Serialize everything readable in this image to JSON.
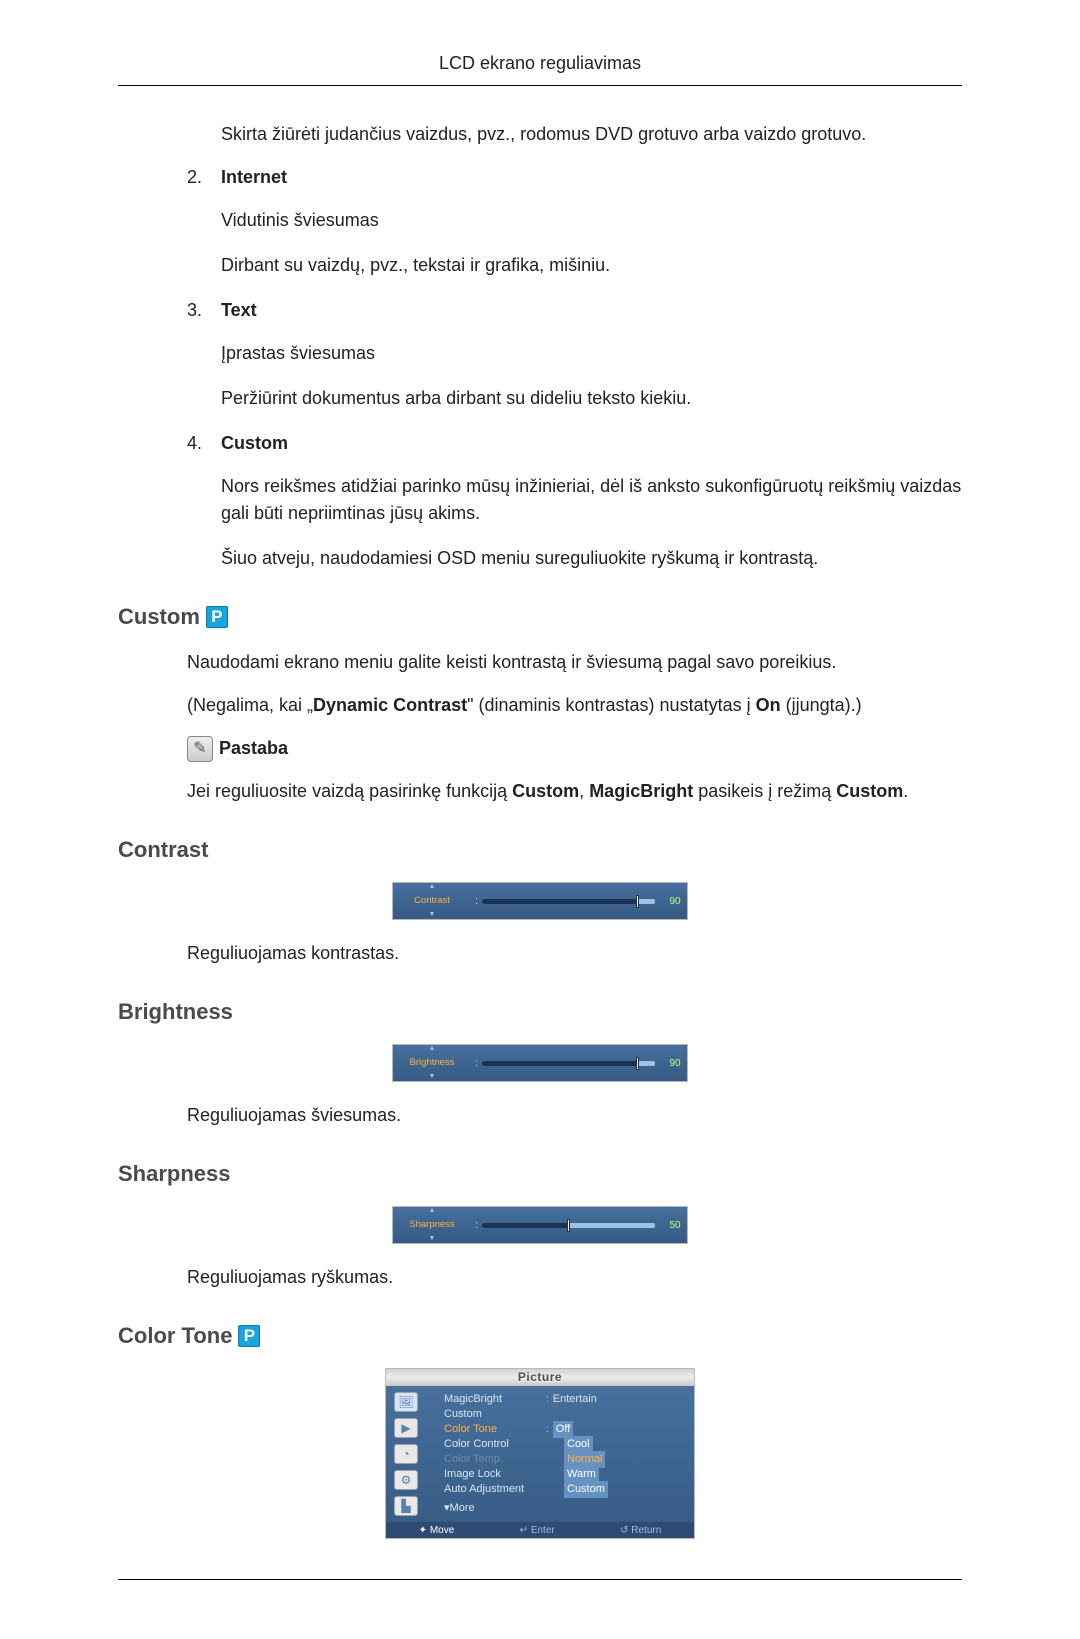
{
  "header": {
    "title": "LCD ekrano reguliavimas"
  },
  "intro_desc": "Skirta žiūrėti judančius vaizdus, pvz., rodomus DVD grotuvo arba vaizdo grotuvo.",
  "items": [
    {
      "num": "2.",
      "title": "Internet",
      "p1": "Vidutinis šviesumas",
      "p2": "Dirbant su vaizdų, pvz., tekstai ir grafika, mišiniu."
    },
    {
      "num": "3.",
      "title": "Text",
      "p1": "Įprastas šviesumas",
      "p2": "Peržiūrint dokumentus arba dirbant su dideliu teksto kiekiu."
    },
    {
      "num": "4.",
      "title": "Custom",
      "p1": "Nors reikšmes atidžiai parinko mūsų inžinieriai, dėl iš anksto sukonfigūruotų reikšmių vaizdas gali būti nepriimtinas jūsų akims.",
      "p2": "Šiuo atveju, naudodamiesi OSD meniu sureguliuokite ryškumą ir kontrastą."
    }
  ],
  "custom_section": {
    "title": "Custom",
    "p1": "Naudodami ekrano meniu galite keisti kontrastą ir šviesumą pagal savo poreikius.",
    "p2_pre": "(Negalima, kai „",
    "p2_b1": "Dynamic Contrast",
    "p2_mid": "\" (dinaminis kontrastas) nustatytas į ",
    "p2_b2": "On",
    "p2_post": " (įjungta).)",
    "note_label": "Pastaba",
    "note_text_pre": "Jei reguliuosite vaizdą pasirinkę funkciją ",
    "note_b1": "Custom",
    "note_mid": ", ",
    "note_b2": "MagicBright",
    "note_mid2": " pasikeis į režimą ",
    "note_b3": "Custom",
    "note_post": "."
  },
  "contrast": {
    "title": "Contrast",
    "osd_label": "Contrast",
    "value": "90",
    "pct": 90,
    "desc": "Reguliuojamas kontrastas."
  },
  "brightness": {
    "title": "Brightness",
    "osd_label": "Brightness",
    "value": "90",
    "pct": 90,
    "desc": "Reguliuojamas šviesumas."
  },
  "sharpness": {
    "title": "Sharpness",
    "osd_label": "Sharpness",
    "value": "50",
    "pct": 50,
    "desc": "Reguliuojamas ryškumas."
  },
  "color_tone": {
    "title": "Color Tone",
    "menu_title": "Picture",
    "rows": [
      {
        "label": "MagicBright",
        "cls": "",
        "sep": ":",
        "val": "Entertain",
        "vcls": "plain"
      },
      {
        "label": "Custom",
        "cls": "",
        "sep": "",
        "val": "",
        "vcls": ""
      },
      {
        "label": "Color Tone",
        "cls": "orange",
        "sep": ":",
        "val": "Off",
        "vcls": "hl"
      },
      {
        "label": "Color Control",
        "cls": "",
        "sep": "",
        "val": "Cool",
        "vcls": "hl"
      },
      {
        "label": "Color Temp.",
        "cls": "dim",
        "sep": "",
        "val": "Normal",
        "vcls": "orange-hl"
      },
      {
        "label": "Image Lock",
        "cls": "",
        "sep": "",
        "val": "Warm",
        "vcls": "hl"
      },
      {
        "label": "Auto Adjustment",
        "cls": "",
        "sep": "",
        "val": "Custom",
        "vcls": "hl"
      }
    ],
    "more": "More",
    "footer": {
      "a": "Move",
      "b": "Enter",
      "c": "Return"
    }
  }
}
